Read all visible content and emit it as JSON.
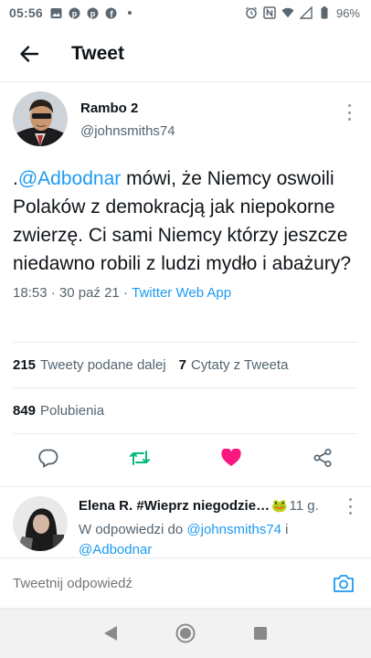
{
  "status_bar": {
    "time": "05:56",
    "battery": "96%",
    "left_icons": [
      "gallery-icon",
      "pinterest-icon",
      "pinterest-icon",
      "facebook-icon",
      "dot-icon"
    ],
    "right_icons": [
      "alarm-icon",
      "nfc-icon",
      "wifi-icon",
      "signal-icon",
      "battery-icon"
    ]
  },
  "header": {
    "title": "Tweet"
  },
  "tweet": {
    "display_name": "Rambo 2",
    "handle": "@johnsmiths74",
    "text_prefix": ".",
    "mention": "@Adbodnar",
    "text_body": " mówi, że Niemcy oswoili Polaków z demokracją jak niepokorne zwierzę. Ci sami Niemcy którzy jeszcze niedawno robili z ludzi mydło i abażury?",
    "time": "18:53",
    "sep1": " · ",
    "date": "30 paź 21",
    "sep2": " · ",
    "app": "Twitter Web App"
  },
  "stats": {
    "retweets_count": "215",
    "retweets_label": "Tweety podane dalej",
    "quotes_count": "7",
    "quotes_label": "Cytaty z Tweeta",
    "likes_count": "849",
    "likes_label": "Polubienia"
  },
  "actions": {
    "icons": [
      "reply-icon",
      "retweet-icon",
      "like-icon",
      "share-icon"
    ],
    "colors": {
      "retweet": "#00ba7c",
      "like": "#f91880",
      "default": "#536471"
    }
  },
  "reply": {
    "display_name": "Elena R. #Wieprz niegodzie…",
    "emoji": "🐸",
    "time": "11 g.",
    "reply_to_prefix": "W odpowiedzi do ",
    "reply_to_user1": "@johnsmiths74",
    "reply_to_mid": " i",
    "reply_to_user2": "@Adbodnar"
  },
  "composer": {
    "placeholder": "Tweetnij odpowiedź"
  },
  "nav": {
    "icons": [
      "back-triangle-icon",
      "home-circle-icon",
      "recents-square-icon"
    ]
  },
  "colors": {
    "accent": "#1d9bf0",
    "text": "#0f1419",
    "muted": "#536471"
  }
}
